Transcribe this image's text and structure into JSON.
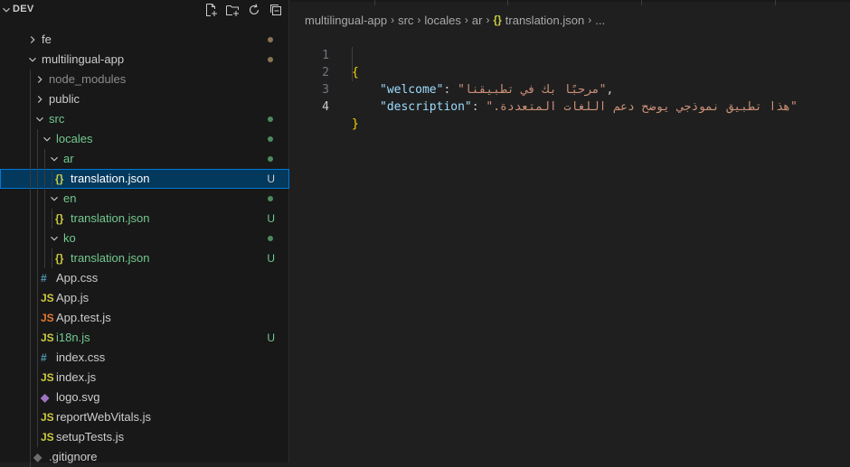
{
  "explorer": {
    "title": "DEV",
    "actions": [
      "new-file-icon",
      "new-folder-icon",
      "refresh-icon",
      "collapse-all-icon"
    ],
    "tree": [
      {
        "label": "fe",
        "type": "folder",
        "expanded": false,
        "decoration": "dot",
        "color": "#cccccc",
        "dotColor": "#8b7355",
        "depth": 0
      },
      {
        "label": "multilingual-app",
        "type": "folder",
        "expanded": true,
        "decoration": "dot",
        "color": "#cccccc",
        "dotColor": "#8b7355",
        "depth": 0
      },
      {
        "label": "node_modules",
        "type": "folder",
        "expanded": false,
        "decoration": "",
        "color": "#8c8c8c",
        "depth": 1
      },
      {
        "label": "public",
        "type": "folder",
        "expanded": false,
        "decoration": "",
        "color": "#cccccc",
        "depth": 1
      },
      {
        "label": "src",
        "type": "folder",
        "expanded": true,
        "decoration": "dot",
        "color": "#73c991",
        "dotColor": "#4e8a5e",
        "depth": 1
      },
      {
        "label": "locales",
        "type": "folder",
        "expanded": true,
        "decoration": "dot",
        "color": "#73c991",
        "dotColor": "#4e8a5e",
        "depth": 2
      },
      {
        "label": "ar",
        "type": "folder",
        "expanded": true,
        "decoration": "dot",
        "color": "#73c991",
        "dotColor": "#4e8a5e",
        "depth": 3
      },
      {
        "label": "translation.json",
        "type": "json",
        "decoration": "U",
        "color": "#ffffff",
        "selected": true,
        "depth": 4
      },
      {
        "label": "en",
        "type": "folder",
        "expanded": true,
        "decoration": "dot",
        "color": "#73c991",
        "dotColor": "#4e8a5e",
        "depth": 3
      },
      {
        "label": "translation.json",
        "type": "json",
        "decoration": "U",
        "color": "#73c991",
        "depth": 4
      },
      {
        "label": "ko",
        "type": "folder",
        "expanded": true,
        "decoration": "dot",
        "color": "#73c991",
        "dotColor": "#4e8a5e",
        "depth": 3
      },
      {
        "label": "translation.json",
        "type": "json",
        "decoration": "U",
        "color": "#73c991",
        "depth": 4
      },
      {
        "label": "App.css",
        "type": "css",
        "decoration": "",
        "color": "#cccccc",
        "depth": 2
      },
      {
        "label": "App.js",
        "type": "js",
        "decoration": "",
        "color": "#cccccc",
        "depth": 2
      },
      {
        "label": "App.test.js",
        "type": "testjs",
        "decoration": "",
        "color": "#cccccc",
        "depth": 2
      },
      {
        "label": "i18n.js",
        "type": "js",
        "decoration": "U",
        "color": "#73c991",
        "depth": 2
      },
      {
        "label": "index.css",
        "type": "css",
        "decoration": "",
        "color": "#cccccc",
        "depth": 2
      },
      {
        "label": "index.js",
        "type": "js",
        "decoration": "",
        "color": "#cccccc",
        "depth": 2
      },
      {
        "label": "logo.svg",
        "type": "svg",
        "decoration": "",
        "color": "#cccccc",
        "depth": 2
      },
      {
        "label": "reportWebVitals.js",
        "type": "js",
        "decoration": "",
        "color": "#cccccc",
        "depth": 2
      },
      {
        "label": "setupTests.js",
        "type": "js",
        "decoration": "",
        "color": "#cccccc",
        "depth": 2
      },
      {
        "label": ".gitignore",
        "type": "gitignore",
        "decoration": "",
        "color": "#cccccc",
        "depth": 1
      }
    ]
  },
  "breadcrumb": {
    "items": [
      "multilingual-app",
      "src",
      "locales",
      "ar"
    ],
    "file_icon": "{}",
    "file": "translation.json",
    "tail": "..."
  },
  "code": {
    "lines": [
      {
        "num": "1",
        "open_brace": "{"
      },
      {
        "num": "2",
        "key": "\"welcome\"",
        "colon": ": ",
        "value": "\"مرحبًا بك في تطبيقنا\"",
        "end": ","
      },
      {
        "num": "3",
        "key": "\"description\"",
        "colon": ": ",
        "value": "\"هذا تطبيق نموذجي يوضح دعم اللغات المتعددة.\"",
        "end": ""
      },
      {
        "num": "4",
        "close_brace": "}"
      }
    ],
    "active_line": "4"
  },
  "colors": {
    "accent": "#0078d4",
    "untracked": "#73c991",
    "json_icon": "#cbcb41",
    "css_icon": "#519aba",
    "js_icon": "#cbcb41",
    "testjs_icon": "#e37933",
    "svg_icon": "#a074c4"
  }
}
